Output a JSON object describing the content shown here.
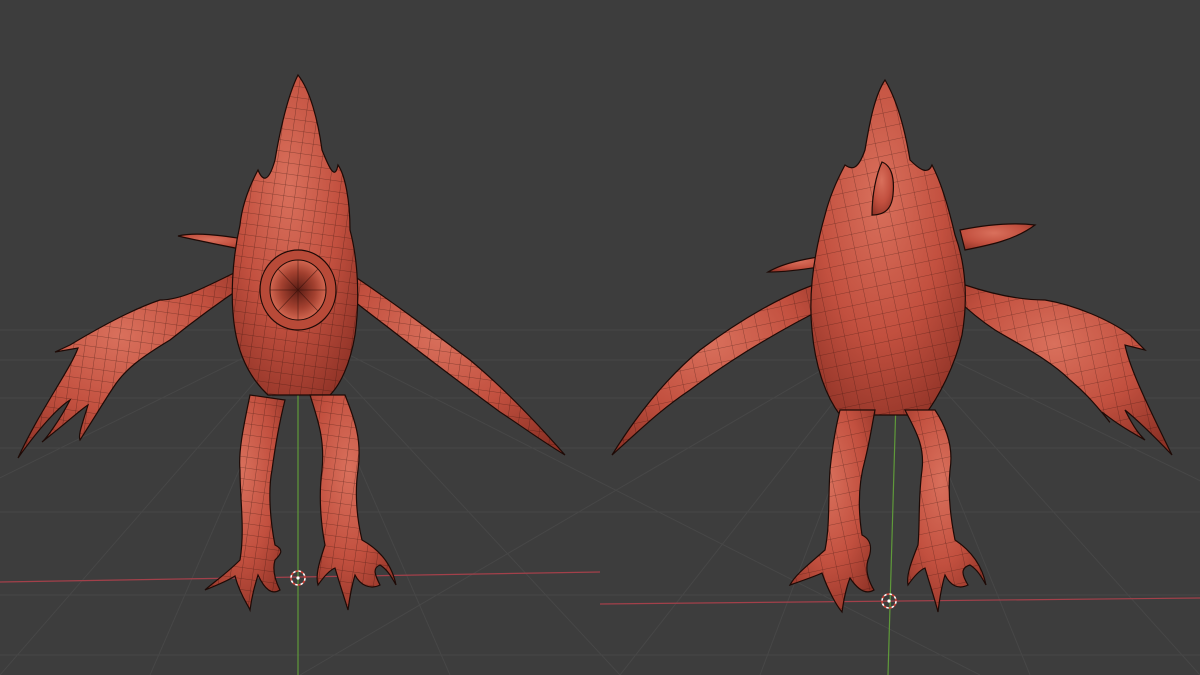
{
  "viewport": {
    "background": "#3d3d3d",
    "grid_color": "#474747",
    "x_axis_color": "#a3404a",
    "y_axis_color": "#5f9a3a",
    "mesh_color": "#c2503f",
    "wire_color": "#2a0c07"
  },
  "objects": [
    {
      "name": "creature-front-view",
      "icon": "mesh-object-icon"
    },
    {
      "name": "creature-back-view",
      "icon": "mesh-object-icon"
    }
  ],
  "cursors": [
    {
      "icon": "3d-cursor-icon"
    },
    {
      "icon": "3d-cursor-icon"
    }
  ]
}
